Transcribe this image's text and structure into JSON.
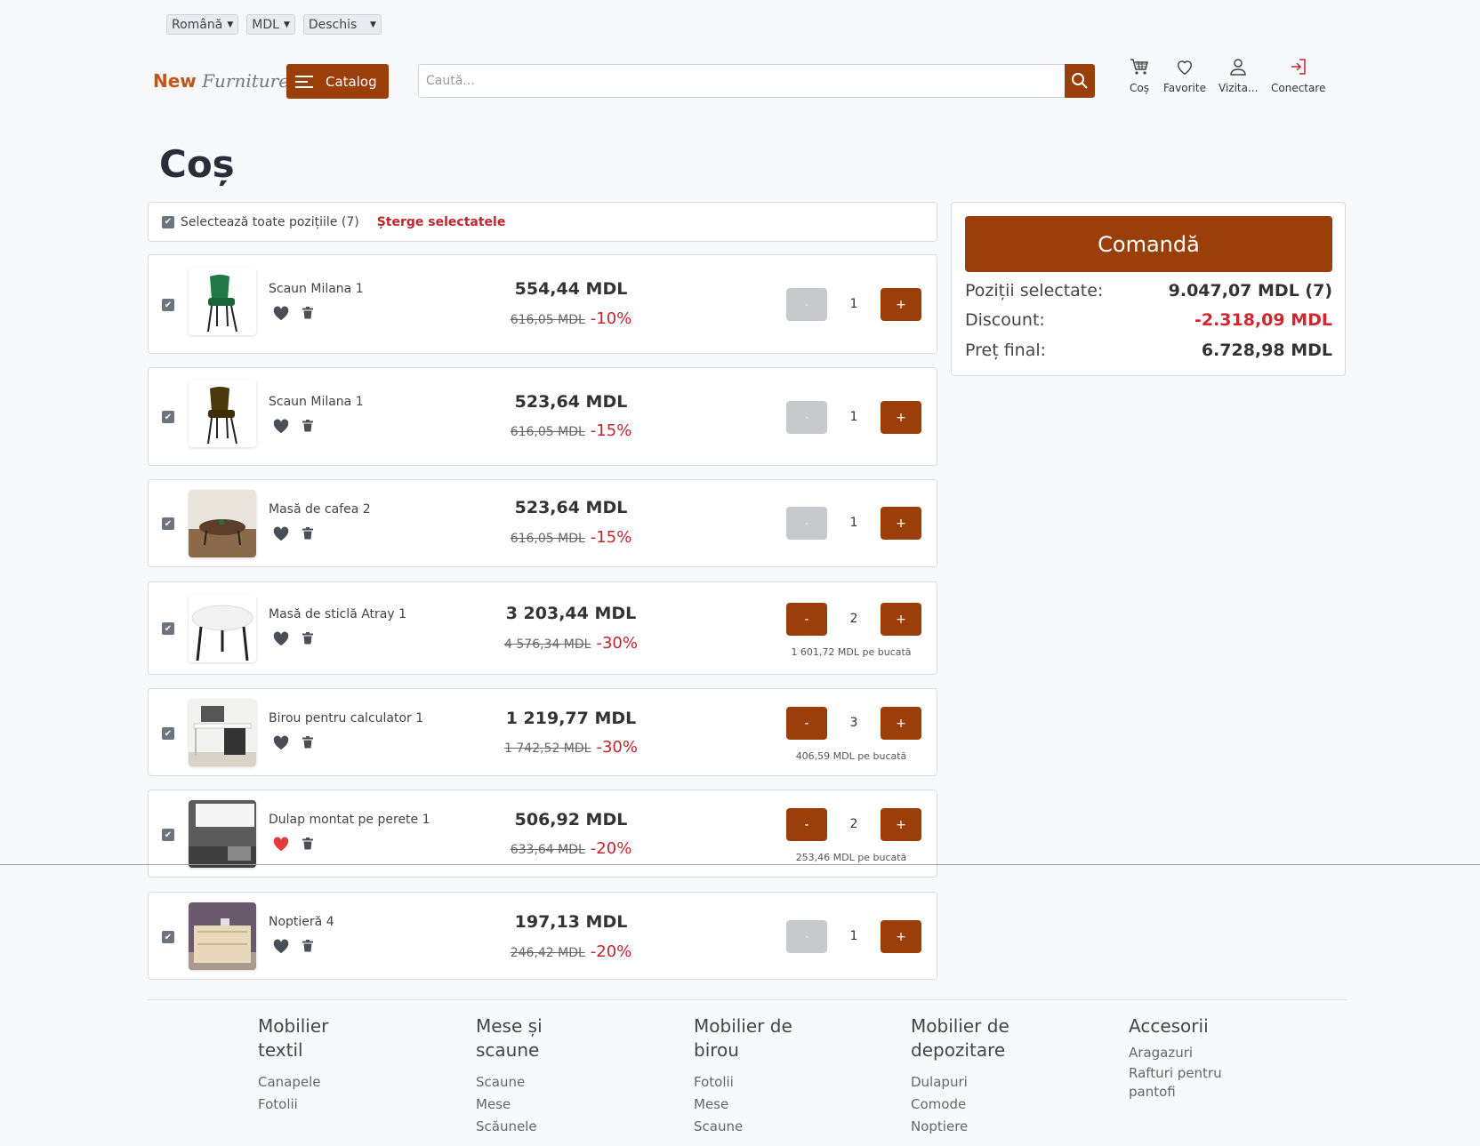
{
  "top_selects": [
    {
      "value": "Română"
    },
    {
      "value": "MDL"
    },
    {
      "value": "Deschis"
    }
  ],
  "header": {
    "logo_part1": "New",
    "logo_part2": "Furniture",
    "catalog_label": "Catalog",
    "search_placeholder": "Caută...",
    "nav": {
      "cart": "Coș",
      "favorites": "Favorite",
      "visitor": "Vizita...",
      "login": "Conectare"
    }
  },
  "page_title": "Coș",
  "select_all": {
    "label": "Selectează toate pozițiile (7)",
    "delete_label": "Șterge selectatele"
  },
  "items": [
    {
      "name": "Scaun Milana 1",
      "price": "554,44 MDL",
      "old_price": "616,05 MDL",
      "discount": "-10%",
      "qty": "1",
      "per_unit": "",
      "minus": "-",
      "plus": "+",
      "favorite": false
    },
    {
      "name": "Scaun Milana 1",
      "price": "523,64 MDL",
      "old_price": "616,05 MDL",
      "discount": "-15%",
      "qty": "1",
      "per_unit": "",
      "minus": "-",
      "plus": "+",
      "favorite": false
    },
    {
      "name": "Masă de cafea 2",
      "price": "523,64 MDL",
      "old_price": "616,05 MDL",
      "discount": "-15%",
      "qty": "1",
      "per_unit": "",
      "minus": "-",
      "plus": "+",
      "favorite": false
    },
    {
      "name": "Masă de sticlă Atray 1",
      "price": "3 203,44 MDL",
      "old_price": "4 576,34 MDL",
      "discount": "-30%",
      "qty": "2",
      "per_unit": "1 601,72 MDL pe bucată",
      "minus": "-",
      "plus": "+",
      "favorite": false
    },
    {
      "name": "Birou pentru calculator 1",
      "price": "1 219,77 MDL",
      "old_price": "1 742,52 MDL",
      "discount": "-30%",
      "qty": "3",
      "per_unit": "406,59 MDL pe bucată",
      "minus": "-",
      "plus": "+",
      "favorite": false
    },
    {
      "name": "Dulap montat pe perete 1",
      "price": "506,92 MDL",
      "old_price": "633,64 MDL",
      "discount": "-20%",
      "qty": "2",
      "per_unit": "253,46 MDL pe bucată",
      "minus": "-",
      "plus": "+",
      "favorite": true
    },
    {
      "name": "Noptieră 4",
      "price": "197,13 MDL",
      "old_price": "246,42 MDL",
      "discount": "-20%",
      "qty": "1",
      "per_unit": "",
      "minus": "-",
      "plus": "+",
      "favorite": false
    }
  ],
  "summary": {
    "order_label": "Comandă",
    "selected_label": "Poziții selectate:",
    "selected_value": "9.047,07 MDL (7)",
    "discount_label": "Discount:",
    "discount_value": "-2.318,09 MDL",
    "final_label": "Preț final:",
    "final_value": "6.728,98 MDL"
  },
  "footer": [
    {
      "title": "Mobilier textil",
      "links": [
        "Canapele",
        "Fotolii"
      ]
    },
    {
      "title": "Mese și scaune",
      "links": [
        "Scaune",
        "Mese",
        "Scăunele"
      ]
    },
    {
      "title": "Mobilier de birou",
      "links": [
        "Fotolii",
        "Mese",
        "Scaune"
      ]
    },
    {
      "title": "Mobilier de depozitare",
      "links": [
        "Dulapuri",
        "Comode",
        "Noptiere"
      ]
    },
    {
      "title": "Accesorii",
      "links": [
        "Aragazuri",
        "Rafturi pentru pantofi"
      ]
    }
  ],
  "colors": {
    "accent": "#9a3f0a",
    "discount_red": "#c0262d",
    "disabled_button": "#c7c9cc"
  }
}
